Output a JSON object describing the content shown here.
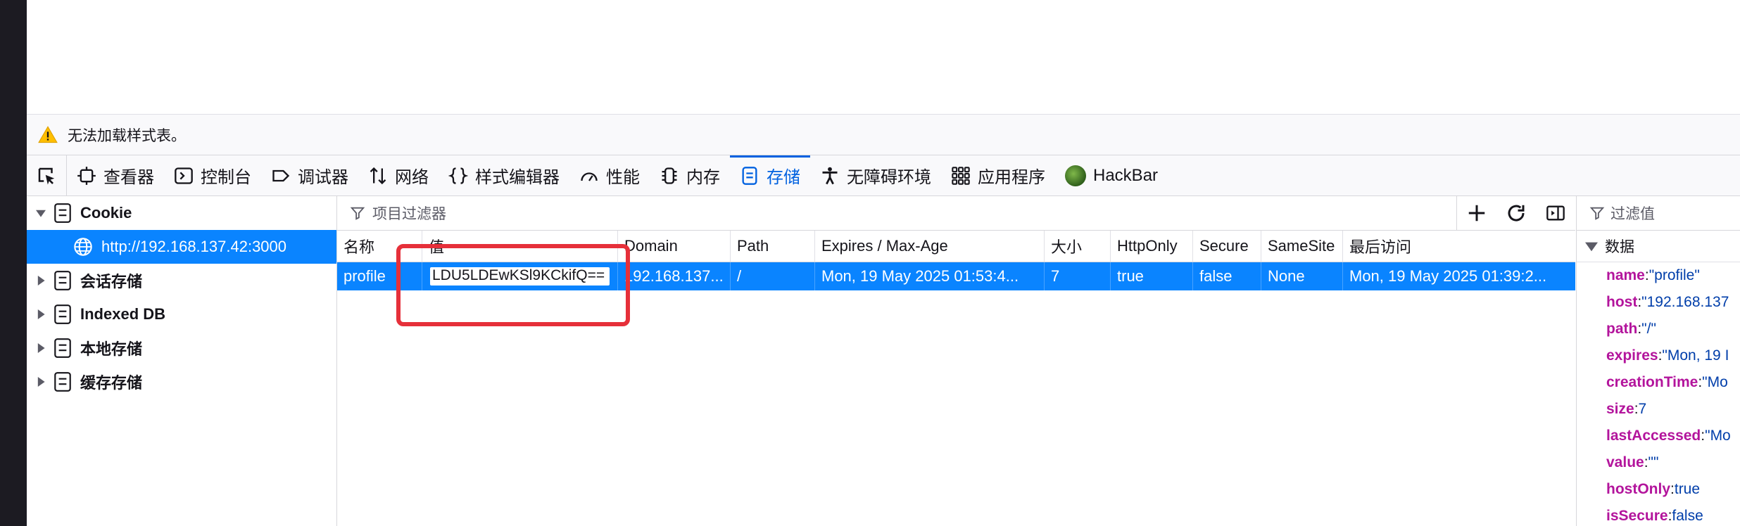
{
  "warning": {
    "text": "无法加载样式表。"
  },
  "toolbar": {
    "tabs": [
      {
        "label": "查看器",
        "icon": "inspector-icon"
      },
      {
        "label": "控制台",
        "icon": "console-icon"
      },
      {
        "label": "调试器",
        "icon": "debugger-icon"
      },
      {
        "label": "网络",
        "icon": "network-icon"
      },
      {
        "label": "样式编辑器",
        "icon": "style-editor-icon"
      },
      {
        "label": "性能",
        "icon": "performance-icon"
      },
      {
        "label": "内存",
        "icon": "memory-icon"
      },
      {
        "label": "存储",
        "icon": "storage-icon",
        "active": true
      },
      {
        "label": "无障碍环境",
        "icon": "accessibility-icon"
      },
      {
        "label": "应用程序",
        "icon": "application-icon"
      },
      {
        "label": "HackBar",
        "icon": "hackbar-icon"
      }
    ]
  },
  "sidebar": {
    "cookie": "Cookie",
    "cookie_host": "http://192.168.137.42:3000",
    "session_storage": "会话存储",
    "indexed_db": "Indexed DB",
    "local_storage": "本地存储",
    "cache_storage": "缓存存储"
  },
  "table": {
    "filter_placeholder": "项目过滤器",
    "columns": {
      "name": "名称",
      "value": "值",
      "domain": "Domain",
      "path": "Path",
      "expires": "Expires / Max-Age",
      "size": "大小",
      "httponly": "HttpOnly",
      "secure": "Secure",
      "samesite": "SameSite",
      "last_access": "最后访问"
    },
    "row": {
      "name": "profile",
      "value": "LDU5LDEwKSl9KCkifQ==",
      "domain": "192.168.137...",
      "path": "/",
      "expires": "Mon, 19 May 2025 01:53:4...",
      "size": "7",
      "httponly": "true",
      "secure": "false",
      "samesite": "None",
      "last_access": "Mon, 19 May 2025 01:39:2..."
    }
  },
  "data_panel": {
    "filter_placeholder": "过滤值",
    "header": "数据",
    "props": [
      {
        "key": "name",
        "value": "\"profile\""
      },
      {
        "key": "host",
        "value": "\"192.168.137"
      },
      {
        "key": "path",
        "value": "\"/\""
      },
      {
        "key": "expires",
        "value": "\"Mon, 19 I"
      },
      {
        "key": "creationTime",
        "value": "\"Mo"
      },
      {
        "key": "size",
        "value": "7"
      },
      {
        "key": "lastAccessed",
        "value": "\"Mo"
      },
      {
        "key": "value",
        "value": "\"\""
      },
      {
        "key": "hostOnly",
        "value": "true"
      },
      {
        "key": "isSecure",
        "value": "false"
      }
    ]
  },
  "colors": {
    "accent": "#0a84ff",
    "active_tab": "#0061e0",
    "highlight_box": "#e6303a",
    "prop_key": "#b3149c"
  }
}
